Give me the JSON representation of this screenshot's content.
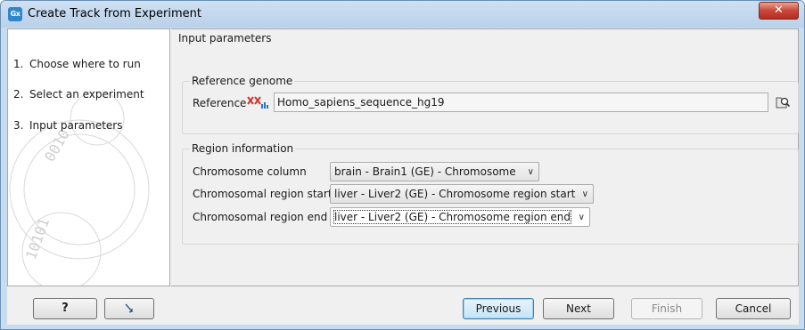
{
  "window": {
    "icon_text": "Gx",
    "title": "Create Track from Experiment",
    "close_glyph": "✕"
  },
  "steps": [
    {
      "num": "1.",
      "label": "Choose where to run"
    },
    {
      "num": "2.",
      "label": "Select an experiment"
    },
    {
      "num": "3.",
      "label": "Input parameters"
    }
  ],
  "panel": {
    "title": "Input parameters"
  },
  "reference_genome": {
    "group_label": "Reference genome",
    "field_label": "Reference",
    "value": "Homo_sapiens_sequence_hg19"
  },
  "region_information": {
    "group_label": "Region information",
    "rows": [
      {
        "label": "Chromosome column",
        "value": "brain - Brain1 (GE) - Chromosome"
      },
      {
        "label": "Chromosomal region start",
        "value": "liver - Liver2 (GE) - Chromosome region start"
      },
      {
        "label": "Chromosomal region end",
        "value": "liver - Liver2 (GE) - Chromosome region end"
      }
    ]
  },
  "buttons": {
    "help": "?",
    "previous": "Previous",
    "next": "Next",
    "finish": "Finish",
    "cancel": "Cancel"
  },
  "icons": {
    "app": "app-logo-icon",
    "dna": "sequence-icon",
    "browse": "browse-folder-icon",
    "reset": "reset-arrow-icon"
  }
}
